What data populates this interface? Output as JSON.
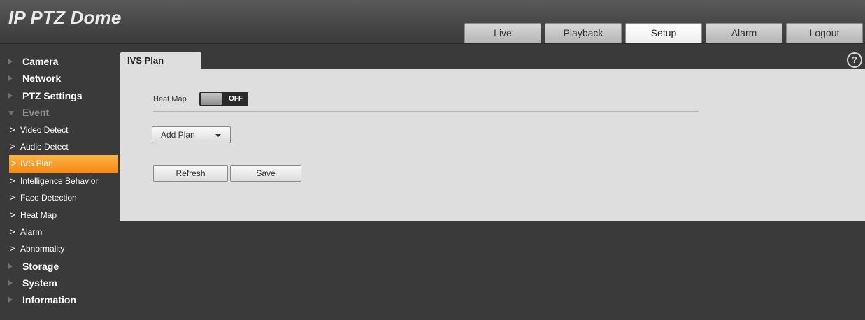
{
  "app": {
    "title": "IP PTZ Dome"
  },
  "nav": {
    "tabs": [
      {
        "label": "Live"
      },
      {
        "label": "Playback"
      },
      {
        "label": "Setup"
      },
      {
        "label": "Alarm"
      },
      {
        "label": "Logout"
      }
    ],
    "active": "Setup"
  },
  "sidebar": {
    "items": [
      {
        "label": "Camera",
        "level": "top"
      },
      {
        "label": "Network",
        "level": "top"
      },
      {
        "label": "PTZ Settings",
        "level": "top"
      },
      {
        "label": "Event",
        "level": "top",
        "expanded": true
      },
      {
        "label": "Video Detect",
        "level": "sub"
      },
      {
        "label": "Audio Detect",
        "level": "sub"
      },
      {
        "label": "IVS Plan",
        "level": "sub",
        "active": true
      },
      {
        "label": "Intelligence Behavior",
        "level": "sub"
      },
      {
        "label": "Face Detection",
        "level": "sub"
      },
      {
        "label": "Heat Map",
        "level": "sub"
      },
      {
        "label": "Alarm",
        "level": "sub"
      },
      {
        "label": "Abnormality",
        "level": "sub"
      },
      {
        "label": "Storage",
        "level": "top"
      },
      {
        "label": "System",
        "level": "top"
      },
      {
        "label": "Information",
        "level": "top"
      }
    ],
    "sub_marker": ">"
  },
  "page": {
    "tab_title": "IVS Plan",
    "help_symbol": "?",
    "heat_map": {
      "label": "Heat Map",
      "state": "OFF"
    },
    "add_plan_label": "Add Plan",
    "refresh_label": "Refresh",
    "save_label": "Save"
  },
  "colors": {
    "active_orange": "#f48a12",
    "panel_bg": "#dedede",
    "page_bg": "#3a3a3a"
  }
}
